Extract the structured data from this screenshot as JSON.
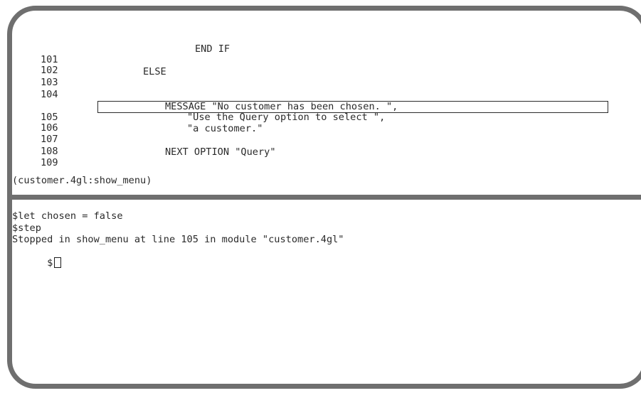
{
  "source": {
    "lines": [
      {
        "num": "101",
        "text": "END IF"
      },
      {
        "num": "102",
        "text": ""
      },
      {
        "num": "103",
        "text": "ELSE"
      },
      {
        "num": "104",
        "text": ""
      },
      {
        "num": "105",
        "text": "MESSAGE \"No customer has been chosen. \","
      },
      {
        "num": "106",
        "text": "\"Use the Query option to select \","
      },
      {
        "num": "107",
        "text": "\"a customer.\""
      },
      {
        "num": "108",
        "text": ""
      },
      {
        "num": "109",
        "text": "NEXT OPTION \"Query\""
      }
    ],
    "current_line": "105",
    "location": "(customer.4gl:show_menu)"
  },
  "command": {
    "history": [
      "$let chosen = false",
      "$step",
      "Stopped in show_menu at line 105 in module \"customer.4gl\""
    ],
    "prompt": "$"
  }
}
